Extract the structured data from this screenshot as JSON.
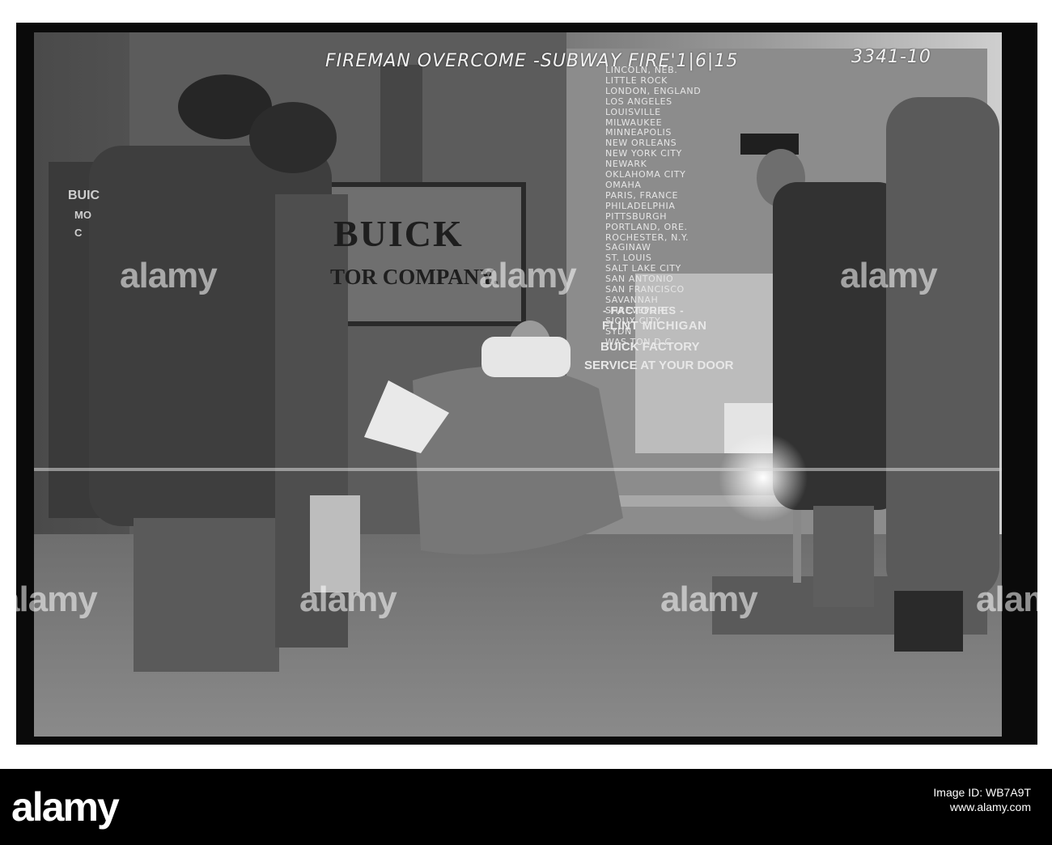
{
  "caption": {
    "title": "FIREMAN OVERCOME -SUBWAY FIRE'1|6|15",
    "number": "3341-10"
  },
  "building_sign": {
    "line1": "BUICK",
    "line2": "TOR COMPANY."
  },
  "left_window": {
    "line1": "BUIC",
    "line2": "MO",
    "line3": "C"
  },
  "window_cities": [
    "LINCOLN, NEB.",
    "LITTLE ROCK",
    "LONDON, ENGLAND",
    "LOS ANGELES",
    "LOUISVILLE",
    "MILWAUKEE",
    "MINNEAPOLIS",
    "NEW ORLEANS",
    "NEW YORK CITY",
    "NEWARK",
    "OKLAHOMA CITY",
    "OMAHA",
    "PARIS, FRANCE",
    "PHILADELPHIA",
    "PITTSBURGH",
    "PORTLAND, ORE.",
    "ROCHESTER, N.Y.",
    "SAGINAW",
    "ST. LOUIS",
    "SALT LAKE CITY",
    "SAN ANTONIO",
    "SAN FRANCISCO",
    "SAVANNAH",
    "SHREVEPORT",
    "SIOUX CITY",
    "SYDN",
    "WAS  TON D.C"
  ],
  "window_poster": {
    "factories": "- FACTORIES -",
    "flint": "FLINT MICHIGAN",
    "buick_factory": "BUICK FACTORY",
    "service": "SERVICE AT YOUR DOOR"
  },
  "watermark": {
    "text": "alamy"
  },
  "banner": {
    "logo": "alamy",
    "image_id": "Image ID: WB7A9T",
    "website": "www.alamy.com"
  },
  "colors": {
    "banner_background": "#000000",
    "banner_text": "#ffffff",
    "photo_border": "#0a0a0a"
  }
}
